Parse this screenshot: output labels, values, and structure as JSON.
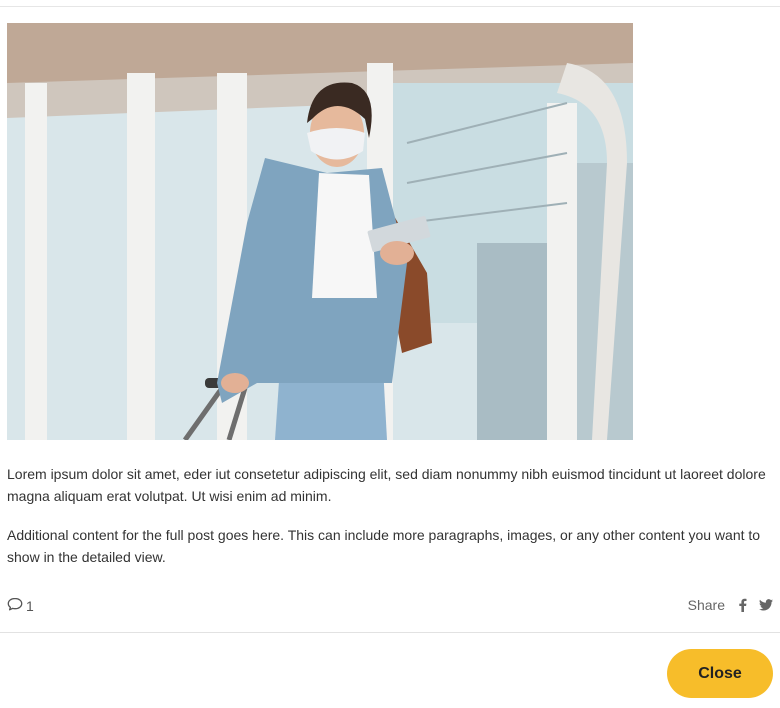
{
  "post": {
    "paragraphs": [
      "Lorem ipsum dolor sit amet, eder iut consetetur adipiscing elit, sed diam nonummy nibh euismod tincidunt ut laoreet dolore magna aliquam erat volutpat. Ut wisi enim ad minim.",
      "Additional content for the full post goes here. This can include more paragraphs, images, or any other content you want to show in the detailed view."
    ],
    "comment_count": "1",
    "share_label": "Share"
  },
  "icons": {
    "comment": "speech-bubble-icon",
    "facebook": "facebook-icon",
    "twitter": "twitter-icon"
  },
  "footer": {
    "close_label": "Close"
  },
  "colors": {
    "accent": "#f7bd2a"
  }
}
